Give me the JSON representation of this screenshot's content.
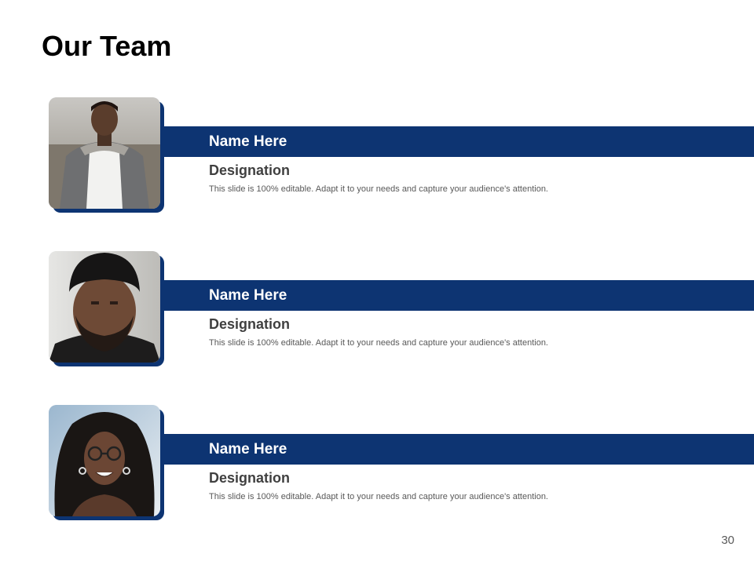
{
  "slide": {
    "title": "Our Team",
    "page_number": "30"
  },
  "colors": {
    "accent": "#0d3472",
    "title": "#000000",
    "designation": "#404040",
    "body_text": "#595959"
  },
  "members": [
    {
      "name": "Name Here",
      "designation": "Designation",
      "description": "This slide is 100% editable. Adapt it to your needs and capture your audience's attention."
    },
    {
      "name": "Name Here",
      "designation": "Designation",
      "description": "This slide is 100% editable. Adapt it to your needs and capture your audience's attention."
    },
    {
      "name": "Name Here",
      "designation": "Designation",
      "description": "This slide is 100% editable. Adapt it to your needs and capture your audience's attention."
    }
  ]
}
